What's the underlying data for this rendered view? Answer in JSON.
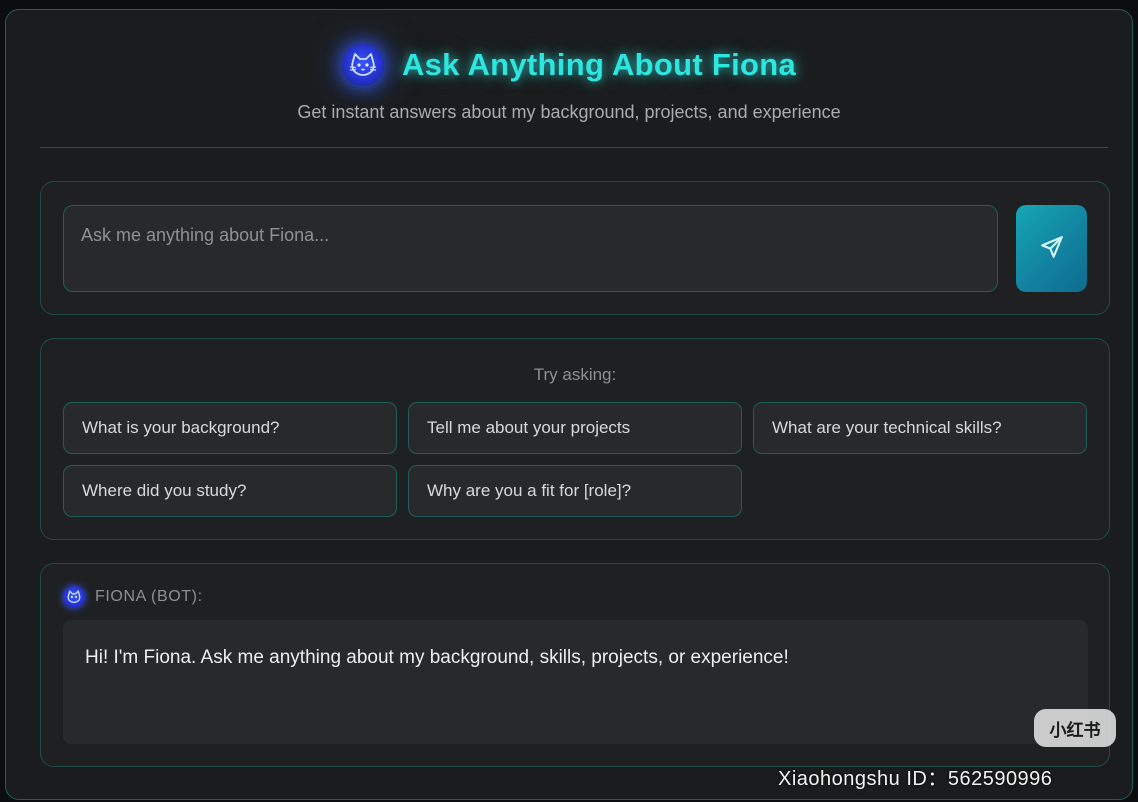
{
  "header": {
    "icon": "cat-face-icon",
    "title": "Ask Anything About Fiona",
    "subtitle": "Get instant answers about my background, projects, and experience"
  },
  "input": {
    "placeholder": "Ask me anything about Fiona...",
    "value": "",
    "send_icon": "send-icon"
  },
  "suggestions": {
    "label": "Try asking:",
    "chips": [
      "What is your background?",
      "Tell me about your projects",
      "What are your technical skills?",
      "Where did you study?",
      "Why are you a fit for [role]?"
    ]
  },
  "chat": {
    "sender_icon": "cat-face-icon",
    "sender": "FIONA (BOT):",
    "message": "Hi! I'm Fiona. Ask me anything about my background, skills, projects, or experience!"
  },
  "watermark": {
    "logo_text": "小红书",
    "id_text": "Xiaohongshu ID：562590996"
  },
  "colors": {
    "accent": "#2ee6e0",
    "border": "#1f5e5a",
    "background": "#1b1c1d",
    "icon_blue": "#2f58ff"
  }
}
